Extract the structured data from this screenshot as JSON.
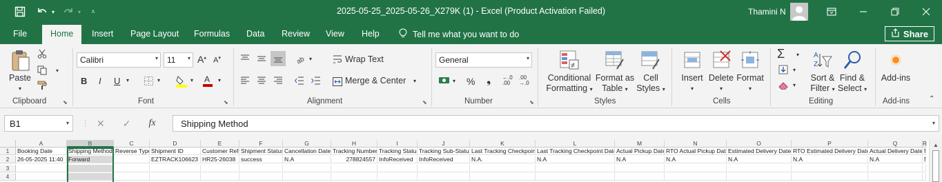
{
  "window": {
    "title": "2025-05-25_2025-05-26_X279K (1)  -  Excel (Product Activation Failed)",
    "user_name": "Thamini N"
  },
  "menu": {
    "tabs": [
      "File",
      "Home",
      "Insert",
      "Page Layout",
      "Formulas",
      "Data",
      "Review",
      "View",
      "Help"
    ],
    "active_tab": "Home",
    "tell_me": "Tell me what you want to do",
    "share": "Share"
  },
  "ribbon": {
    "clipboard": {
      "label": "Clipboard",
      "paste": "Paste"
    },
    "font": {
      "label": "Font",
      "font_name": "Calibri",
      "font_size": "11",
      "bold": "B",
      "italic": "I",
      "underline": "U"
    },
    "alignment": {
      "label": "Alignment",
      "wrap_text": "Wrap Text",
      "merge_center": "Merge & Center"
    },
    "number": {
      "label": "Number",
      "format": "General",
      "percent": "%"
    },
    "styles": {
      "label": "Styles",
      "conditional_formatting": [
        "Conditional",
        "Formatting"
      ],
      "format_as_table": [
        "Format as",
        "Table"
      ],
      "cell_styles": [
        "Cell",
        "Styles"
      ]
    },
    "cells": {
      "label": "Cells",
      "insert": "Insert",
      "delete": "Delete",
      "format": "Format"
    },
    "editing": {
      "label": "Editing",
      "sort_filter": [
        "Sort &",
        "Filter"
      ],
      "find_select": [
        "Find &",
        "Select"
      ]
    },
    "addins": {
      "label": "Add-ins",
      "button": "Add-ins"
    }
  },
  "formula_bar": {
    "name_box": "B1",
    "fx": "fx",
    "value": "Shipping Method"
  },
  "sheet": {
    "columns": [
      "A",
      "B",
      "C",
      "D",
      "E",
      "F",
      "G",
      "H",
      "I",
      "J",
      "K",
      "L",
      "M",
      "N",
      "O",
      "P",
      "Q",
      "R"
    ],
    "selected_column": "B",
    "row_numbers": [
      "1",
      "2",
      "3",
      "4"
    ],
    "rows": [
      [
        "Booking Date",
        "Shipping Method",
        "Reverse Type",
        "Shipment ID",
        "Customer Reference",
        "Shipment Status",
        "Cancellation Date",
        "Tracking Number",
        "Tracking Status",
        "Tracking Sub-Status",
        "Last Tracking Checkpoint",
        "Last Tracking Checkpoint Date",
        "Actual Pickup Date",
        "RTO Actual Pickup Date",
        "Estimated Delivery Date",
        "RTO Estimated Delivery Date",
        "Actual Delivery Date",
        "N"
      ],
      [
        "26-05-2025 11:40",
        "Forward",
        "",
        "EZTRACK106623",
        "HR25-26038",
        "success",
        "N.A",
        "278824557",
        "InfoReceived",
        "InfoReceived",
        "N.A.",
        "N.A",
        "N.A",
        "N.A",
        "N.A",
        "N.A",
        "N.A",
        "N"
      ],
      [
        "",
        "",
        "",
        "",
        "",
        "",
        "",
        "",
        "",
        "",
        "",
        "",
        "",
        "",
        "",
        "",
        "",
        ""
      ],
      [
        "",
        "",
        "",
        "",
        "",
        "",
        "",
        "",
        "",
        "",
        "",
        "",
        "",
        "",
        "",
        "",
        "",
        ""
      ]
    ]
  },
  "colors": {
    "accent": "#217346",
    "ribbon_bg": "#f3f3f3",
    "selection": "#d9d9d9"
  }
}
